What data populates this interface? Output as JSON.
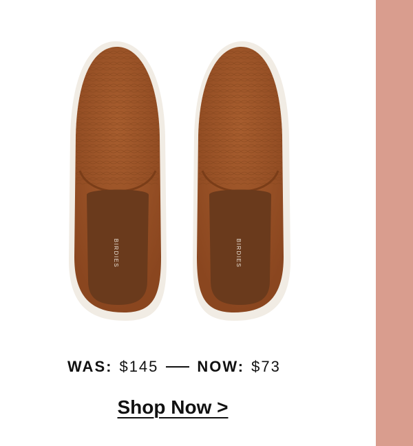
{
  "product": {
    "brand_mark": "BIRDIES",
    "image_alt": "Brown snake-embossed slip-on sneakers",
    "colors": {
      "upper": "#9a5328",
      "sole": "#f1ece4",
      "insole": "#6a3a1c",
      "accent_bar": "#d99d8e"
    }
  },
  "pricing": {
    "was_label": "WAS:",
    "was_value": "$145",
    "now_label": "NOW:",
    "now_value": "$73"
  },
  "cta": {
    "label": "Shop Now >"
  }
}
